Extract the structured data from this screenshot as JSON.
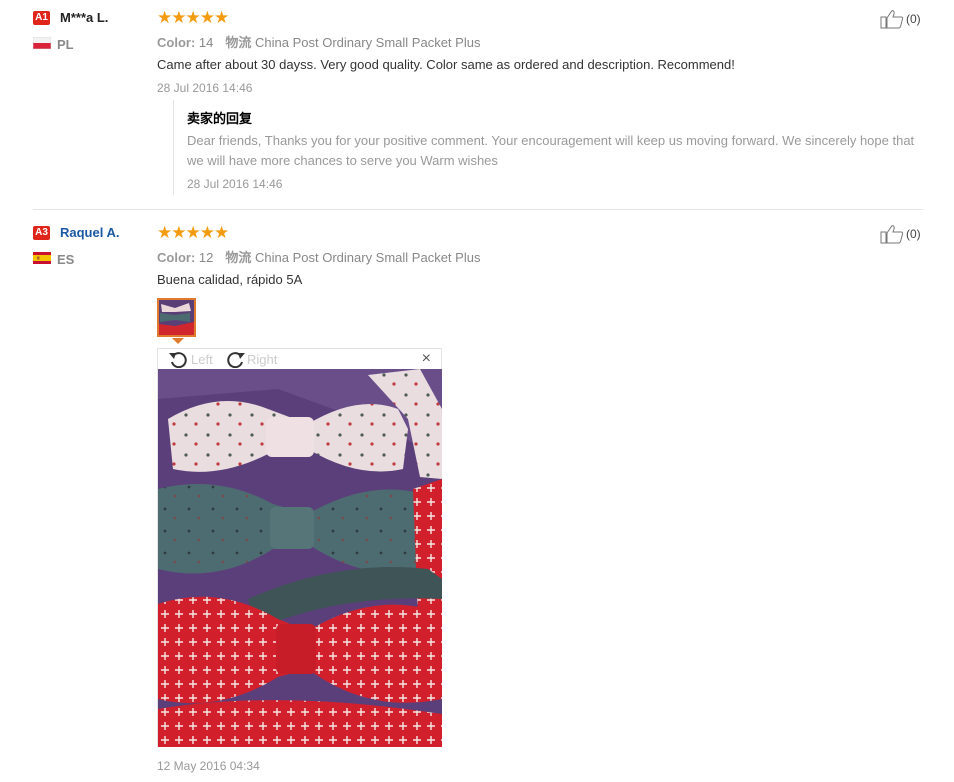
{
  "reviews": [
    {
      "level": "A1",
      "name": "M***a L.",
      "country": "PL",
      "stars": "★★★★★",
      "color_label": "Color:",
      "color_value": "14",
      "shipping_label": "物流",
      "shipping_value": "China Post Ordinary Small Packet Plus",
      "text": "Came after about 30 dayss. Very good quality. Color same as ordered and description. Recommend!",
      "date": "28 Jul 2016 14:46",
      "like_count": "(0)",
      "reply": {
        "title": "卖家的回复",
        "text": "Dear friends, Thanks you for your positive comment. Your encouragement will keep us moving forward. We sincerely hope that we will have more chances to serve you Warm wishes",
        "date": "28 Jul 2016 14:46"
      }
    },
    {
      "level": "A3",
      "name": "Raquel A.",
      "country": "ES",
      "stars": "★★★★★",
      "color_label": "Color:",
      "color_value": "12",
      "shipping_label": "物流",
      "shipping_value": "China Post Ordinary Small Packet Plus",
      "text": "Buena calidad, rápido 5A",
      "date": "12 May 2016 04:34",
      "like_count": "(0)",
      "viewer": {
        "rotate_left": "Left",
        "rotate_right": "Right",
        "close": "×"
      }
    }
  ],
  "colors": {
    "level_badge": "#e0261b",
    "stars": "#f39c12",
    "thumb_border": "#e07a2e",
    "name_link": "#1a59a4"
  },
  "icons": [
    "thumbs-up-icon",
    "rotate-left-icon",
    "rotate-right-icon",
    "close-icon",
    "flag-pl-icon",
    "flag-es-icon"
  ]
}
